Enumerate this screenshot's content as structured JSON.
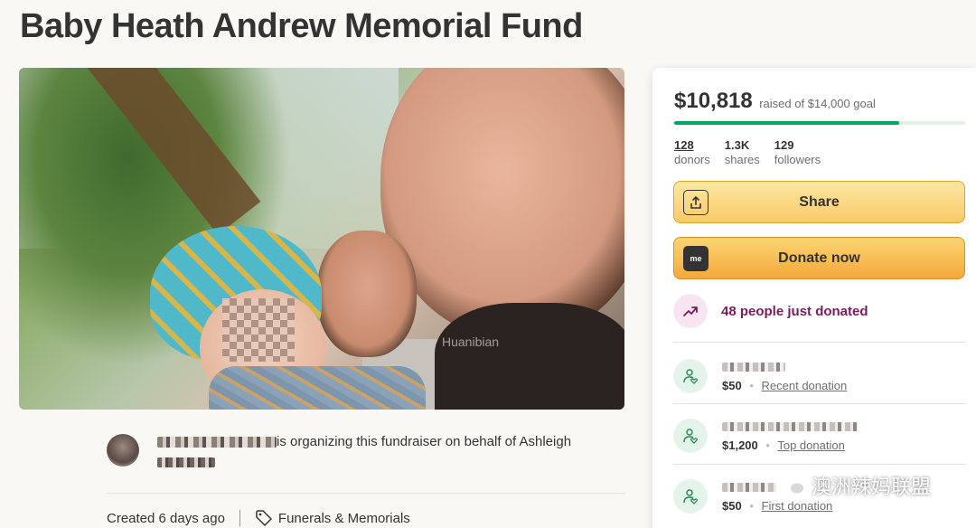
{
  "page": {
    "title": "Baby Heath Andrew Memorial Fund"
  },
  "hero": {
    "watermark": "Huanibian"
  },
  "organizer": {
    "text": "is organizing this fundraiser on behalf of Ashleigh"
  },
  "meta": {
    "created": "Created 6 days ago",
    "category": "Funerals & Memorials"
  },
  "sidebar": {
    "raised_amount": "$10,818",
    "raised_goal": "raised of $14,000 goal",
    "progress_fraction": 0.773,
    "stats": [
      {
        "value": "128",
        "label": "donors"
      },
      {
        "value": "1.3K",
        "label": "shares"
      },
      {
        "value": "129",
        "label": "followers"
      }
    ],
    "share_label": "Share",
    "donate_label": "Donate now",
    "donate_icon_text": "me",
    "trending": "48 people just donated",
    "donations": [
      {
        "amount": "$50",
        "kind": "Recent donation"
      },
      {
        "amount": "$1,200",
        "kind": "Top donation"
      },
      {
        "amount": "$50",
        "kind": "First donation"
      }
    ]
  },
  "watermark_overlay": "澳洲辣妈联盟",
  "colors": {
    "accent_green": "#02a95c",
    "button_yellow": "#f9c968",
    "trend_purple": "#7a1c5c"
  }
}
